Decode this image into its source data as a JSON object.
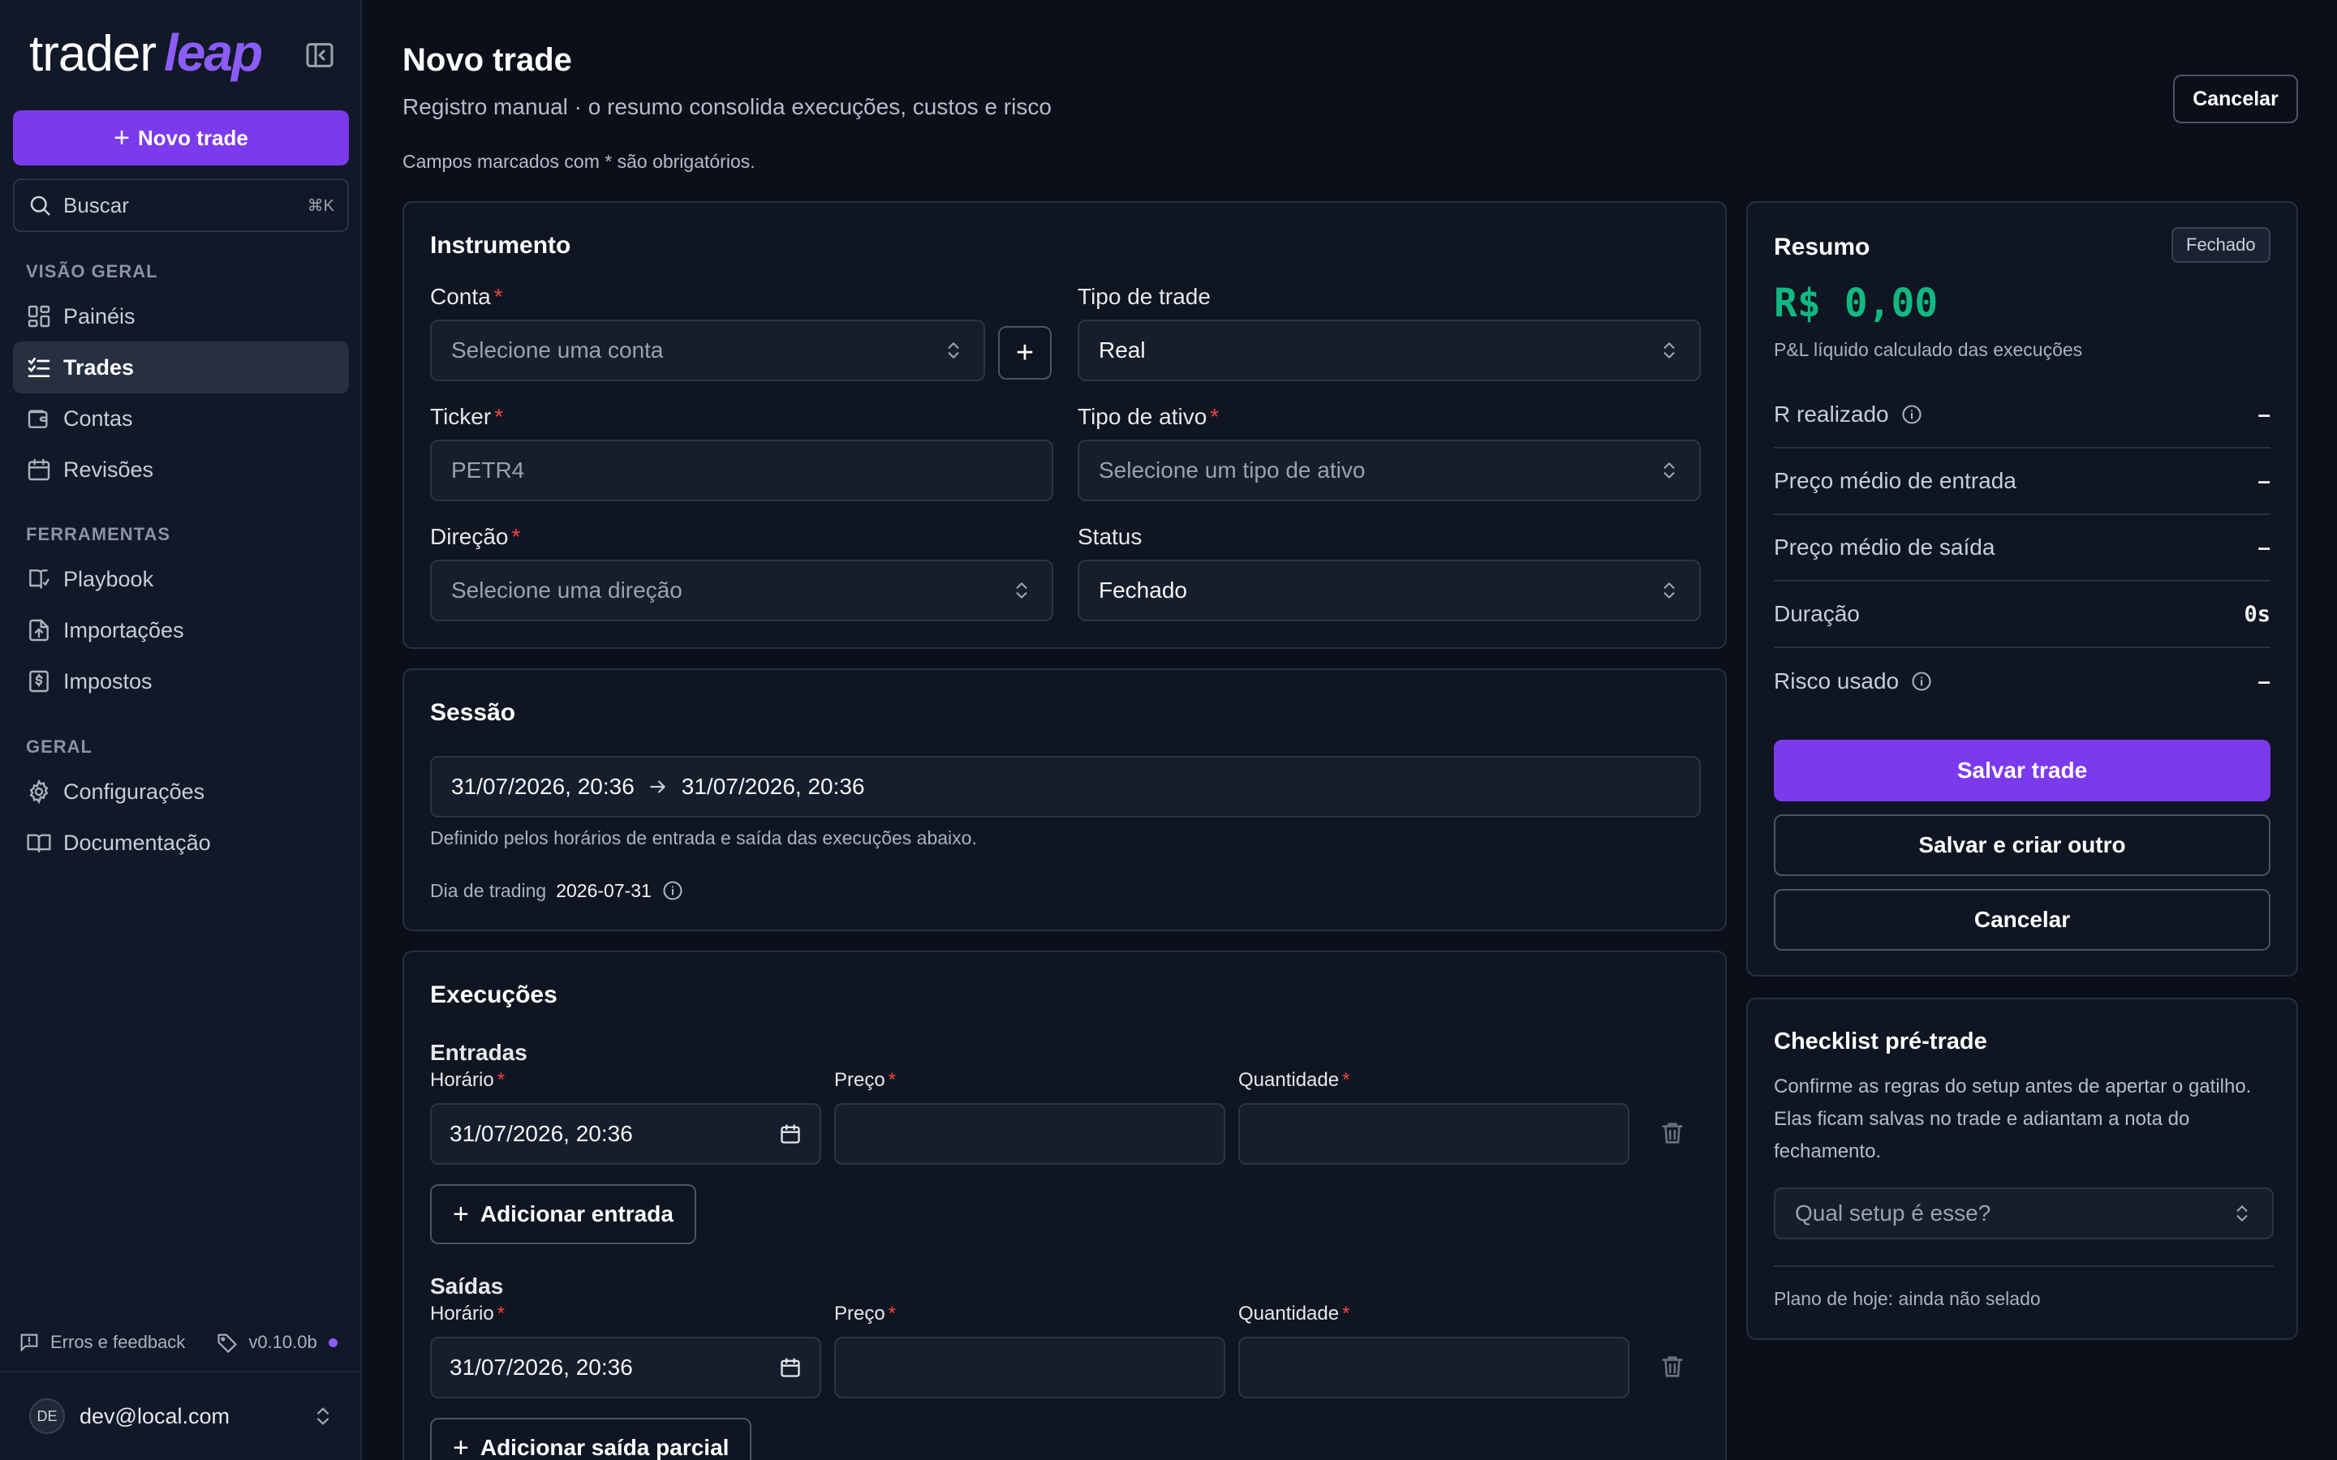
{
  "brand": {
    "word1": "trader",
    "word2": "leap"
  },
  "sidebar": {
    "new_trade": "Novo trade",
    "search": {
      "placeholder": "Buscar",
      "shortcut": "⌘K"
    },
    "sections": [
      {
        "heading": "VISÃO GERAL",
        "items": [
          {
            "label": "Painéis",
            "icon": "dashboard-icon"
          },
          {
            "label": "Trades",
            "icon": "list-check-icon",
            "active": true
          },
          {
            "label": "Contas",
            "icon": "wallet-icon"
          },
          {
            "label": "Revisões",
            "icon": "calendar-icon"
          }
        ]
      },
      {
        "heading": "FERRAMENTAS",
        "items": [
          {
            "label": "Playbook",
            "icon": "book-icon"
          },
          {
            "label": "Importações",
            "icon": "file-import-icon"
          },
          {
            "label": "Impostos",
            "icon": "receipt-icon"
          }
        ]
      },
      {
        "heading": "GERAL",
        "items": [
          {
            "label": "Configurações",
            "icon": "gear-icon"
          },
          {
            "label": "Documentação",
            "icon": "open-book-icon"
          }
        ]
      }
    ],
    "feedback": "Erros e feedback",
    "version": "v0.10.0b",
    "user": {
      "initials": "DE",
      "email": "dev@local.com"
    }
  },
  "header": {
    "title": "Novo trade",
    "subtitle": "Registro manual · o resumo consolida execuções, custos e risco",
    "note": "Campos marcados com * são obrigatórios.",
    "cancel": "Cancelar"
  },
  "instrument": {
    "title": "Instrumento",
    "account": {
      "label": "Conta",
      "placeholder": "Selecione uma conta"
    },
    "trade_type": {
      "label": "Tipo de trade",
      "value": "Real"
    },
    "ticker": {
      "label": "Ticker",
      "placeholder": "PETR4"
    },
    "asset_type": {
      "label": "Tipo de ativo",
      "placeholder": "Selecione um tipo de ativo"
    },
    "direction": {
      "label": "Direção",
      "placeholder": "Selecione uma direção"
    },
    "status": {
      "label": "Status",
      "value": "Fechado"
    }
  },
  "session": {
    "title": "Sessão",
    "start": "31/07/2026, 20:36",
    "end": "31/07/2026, 20:36",
    "help": "Definido pelos horários de entrada e saída das execuções abaixo.",
    "trading_day_label": "Dia de trading",
    "trading_day": "2026-07-31"
  },
  "executions": {
    "title": "Execuções",
    "entries": {
      "title": "Entradas",
      "time_label": "Horário",
      "price_label": "Preço",
      "qty_label": "Quantidade",
      "time_value": "31/07/2026, 20:36",
      "add": "Adicionar entrada"
    },
    "exits": {
      "title": "Saídas",
      "time_label": "Horário",
      "price_label": "Preço",
      "qty_label": "Quantidade",
      "time_value": "31/07/2026, 20:36",
      "add": "Adicionar saída parcial"
    }
  },
  "summary": {
    "title": "Resumo",
    "badge": "Fechado",
    "pnl": "R$ 0,00",
    "pnl_caption": "P&L líquido calculado das execuções",
    "metrics": [
      {
        "label": "R realizado",
        "value": "–",
        "info": true
      },
      {
        "label": "Preço médio de entrada",
        "value": "–"
      },
      {
        "label": "Preço médio de saída",
        "value": "–"
      },
      {
        "label": "Duração",
        "value": "0s"
      },
      {
        "label": "Risco usado",
        "value": "–",
        "info": true
      }
    ],
    "save": "Salvar trade",
    "save_new": "Salvar e criar outro",
    "cancel": "Cancelar"
  },
  "checklist": {
    "title": "Checklist pré-trade",
    "description": "Confirme as regras do setup antes de apertar o gatilho. Elas ficam salvas no trade e adiantam a nota do fechamento.",
    "setup_placeholder": "Qual setup é esse?",
    "plan": "Plano de hoje: ainda não selado"
  },
  "colors": {
    "accent": "#7c3aed",
    "pnl": "#10b981",
    "required": "#ef4444",
    "background": "#0b0f19"
  }
}
